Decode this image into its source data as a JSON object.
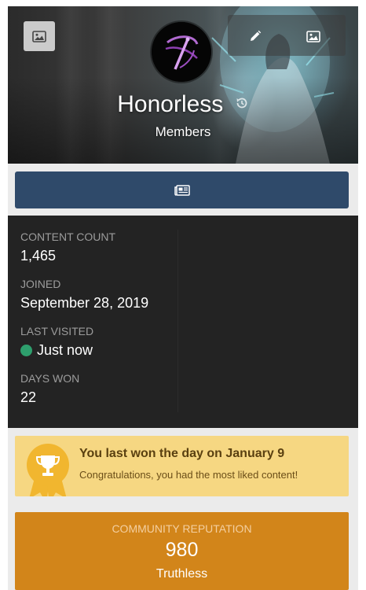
{
  "profile": {
    "name": "Honorless",
    "group": "Members"
  },
  "stats": [
    {
      "label": "CONTENT COUNT",
      "value": "1,465"
    },
    {
      "label": "JOINED",
      "value": "September 28, 2019"
    },
    {
      "label": "LAST VISITED",
      "value": "Just now"
    },
    {
      "label": "DAYS WON",
      "value": "22"
    }
  ],
  "day_won": {
    "title": "You last won the day on January 9",
    "subtitle": "Congratulations, you had the most liked content!"
  },
  "reputation": {
    "label": "COMMUNITY REPUTATION",
    "value": "980",
    "title": "Truthless"
  },
  "colors": {
    "action_button": "#2f4a6a",
    "stats_bg": "#232323",
    "online": "#2e9f6d",
    "day_won_bg": "#f6d782",
    "trophy": "#f1b62f",
    "reputation_bg": "#d2851a"
  },
  "icons": {
    "cover_photo": "image-icon",
    "edit": "pencil-icon",
    "cover_image": "image-icon",
    "history": "history-icon",
    "action": "newspaper-icon",
    "trophy": "trophy-icon"
  }
}
